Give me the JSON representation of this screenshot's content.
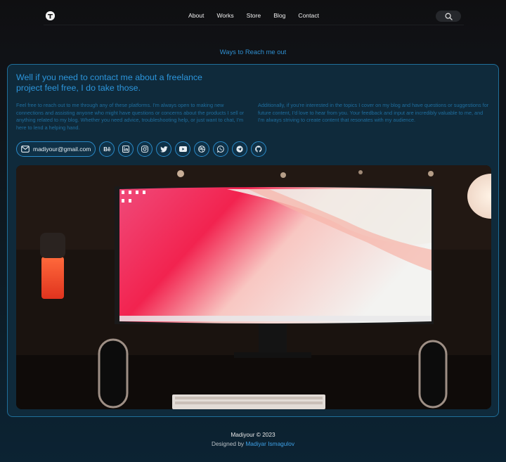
{
  "nav": {
    "logo_icon": "brand-logo-icon",
    "links": [
      "About",
      "Works",
      "Store",
      "Blog",
      "Contact"
    ],
    "search_icon": "search-icon"
  },
  "hero": {
    "subtitle": "Ways to Reach me out"
  },
  "card": {
    "title": "Well if you need to contact me about a freelance project feel free, I do take those.",
    "para_left": "Feel free to reach out to me through any of these platforms. I'm always open to making new connections and assisting anyone who might have questions or concerns about the products I sell or anything related to my blog. Whether you need advice, troubleshooting help, or just want to chat, I'm here to lend a helping hand.",
    "para_right": "Additionally, if you're interested in the topics I cover on my blog and have questions or suggestions for future content, I'd love to hear from you. Your feedback and input are incredibly valuable to me, and I'm always striving to create content that resonates with my audience.",
    "email": "madiyour@gmail.com",
    "socials": [
      "behance",
      "linkedin",
      "instagram",
      "twitter",
      "youtube",
      "dribbble",
      "whatsapp",
      "telegram",
      "github"
    ],
    "behance_label": "Bē",
    "photo_icon": "desk-setup-photo"
  },
  "footer": {
    "copyright": "Madiyour © 2023",
    "designed_by": "Designed by",
    "author": "Madiyar Ismagulov"
  },
  "colors": {
    "accent": "#2c95db",
    "card_bg": "#0f2a3b",
    "border": "#1f6f9a"
  }
}
